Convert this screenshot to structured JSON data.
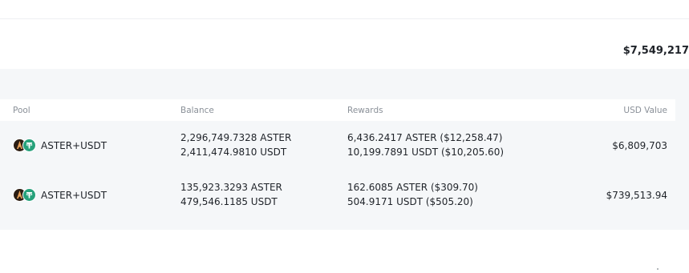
{
  "summary": {
    "total_value": "$7,549,217"
  },
  "table": {
    "headers": {
      "pool": "Pool",
      "balance": "Balance",
      "rewards": "Rewards",
      "usd_value": "USD Value"
    },
    "rows": [
      {
        "pool": "ASTER+USDT",
        "icons": [
          "aster-token-icon",
          "usdt-token-icon"
        ],
        "balance": [
          "2,296,749.7328 ASTER",
          "2,411,474.9810 USDT"
        ],
        "rewards": [
          "6,436.2417 ASTER ($12,258.47)",
          "10,199.7891 USDT ($10,205.60)"
        ],
        "usd_value": "$6,809,703"
      },
      {
        "pool": "ASTER+USDT",
        "icons": [
          "aster-token-icon",
          "usdt-token-icon"
        ],
        "balance": [
          "135,923.3293 ASTER",
          "479,546.1185 USDT"
        ],
        "rewards": [
          "162.6085 ASTER ($309.70)",
          "504.9171 USDT ($505.20)"
        ],
        "usd_value": "$739,513.94"
      }
    ]
  },
  "colors": {
    "panel_background": "#f5f7f9",
    "header_text": "#8a9098",
    "usdt": "#26a17b",
    "aster": "#2b1d13"
  }
}
